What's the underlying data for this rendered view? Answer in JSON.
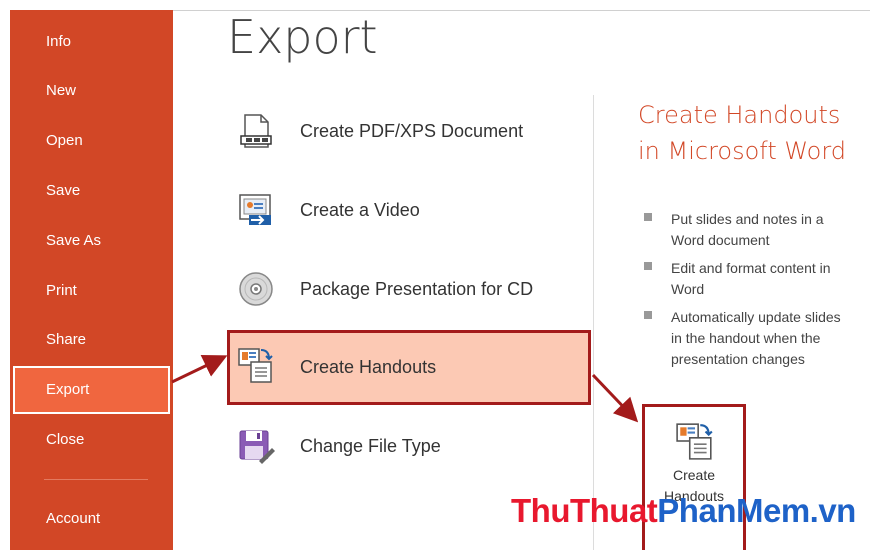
{
  "sidebar": {
    "items": [
      {
        "label": "Info"
      },
      {
        "label": "New"
      },
      {
        "label": "Open"
      },
      {
        "label": "Save"
      },
      {
        "label": "Save As"
      },
      {
        "label": "Print"
      },
      {
        "label": "Share"
      },
      {
        "label": "Export",
        "active": true
      },
      {
        "label": "Close"
      },
      {
        "label": "Account"
      }
    ]
  },
  "main": {
    "title": "Export",
    "options": [
      {
        "label": "Create PDF/XPS Document",
        "icon": "pdf-document-icon"
      },
      {
        "label": "Create a Video",
        "icon": "video-icon"
      },
      {
        "label": "Package Presentation for CD",
        "icon": "cd-disc-icon"
      },
      {
        "label": "Create Handouts",
        "icon": "handouts-icon",
        "selected": true
      },
      {
        "label": "Change File Type",
        "icon": "change-file-type-icon"
      }
    ]
  },
  "detail": {
    "title": "Create Handouts in Microsoft Word",
    "bullets": [
      "Put slides and notes in a Word document",
      "Edit and format content in Word",
      "Automatically update slides in the handout when the presentation changes"
    ],
    "button_label": "Create Handouts"
  },
  "watermark": {
    "part1": "ThuThuat",
    "part2": "PhanMem.vn"
  },
  "colors": {
    "accent": "#d24726",
    "active_nav": "#f0663f",
    "highlight": "#fcc9b4",
    "annotation": "#a31b1b"
  }
}
